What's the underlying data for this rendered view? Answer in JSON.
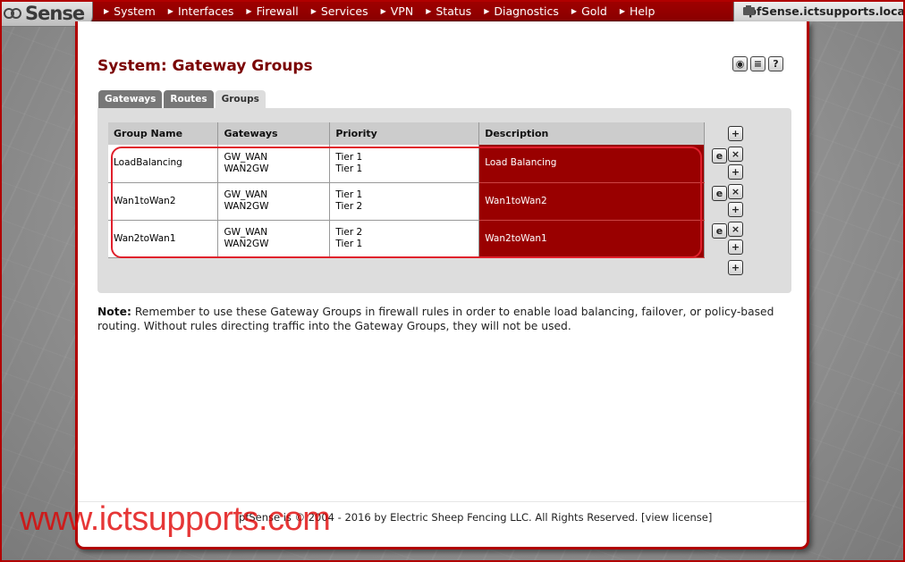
{
  "brand": {
    "logo_text": "Sense",
    "hostname": "pfSense.ictsupports.local"
  },
  "nav": {
    "items": [
      {
        "label": "System"
      },
      {
        "label": "Interfaces"
      },
      {
        "label": "Firewall"
      },
      {
        "label": "Services"
      },
      {
        "label": "VPN"
      },
      {
        "label": "Status"
      },
      {
        "label": "Diagnostics"
      },
      {
        "label": "Gold"
      },
      {
        "label": "Help"
      }
    ]
  },
  "page": {
    "title": "System: Gateway Groups"
  },
  "title_icons": [
    "status-icon",
    "log-icon",
    "help-icon"
  ],
  "tabs": [
    {
      "label": "Gateways",
      "active": false
    },
    {
      "label": "Routes",
      "active": false
    },
    {
      "label": "Groups",
      "active": true
    }
  ],
  "table": {
    "headers": [
      "Group Name",
      "Gateways",
      "Priority",
      "Description"
    ],
    "rows": [
      {
        "name": "LoadBalancing",
        "gw1": "GW_WAN",
        "gw2": "WAN2GW",
        "p1": "Tier 1",
        "p2": "Tier 1",
        "desc": "Load Balancing"
      },
      {
        "name": "Wan1toWan2",
        "gw1": "GW_WAN",
        "gw2": "WAN2GW",
        "p1": "Tier 1",
        "p2": "Tier 2",
        "desc": "Wan1toWan2"
      },
      {
        "name": "Wan2toWan1",
        "gw1": "GW_WAN",
        "gw2": "WAN2GW",
        "p1": "Tier 2",
        "p2": "Tier 1",
        "desc": "Wan2toWan1"
      }
    ]
  },
  "note": {
    "label": "Note:",
    "text": "Remember to use these Gateway Groups in firewall rules in order to enable load balancing, failover, or policy-based routing. Without rules directing traffic into the Gateway Groups, they will not be used."
  },
  "footer": {
    "text": "pfSense is © 2004 - 2016 by Electric Sheep Fencing LLC. All Rights Reserved. [view license]"
  },
  "watermark": "www.ictsupports.com",
  "colors": {
    "brand_red": "#990000",
    "highlight": "#e0202c",
    "title": "#7a0000"
  }
}
